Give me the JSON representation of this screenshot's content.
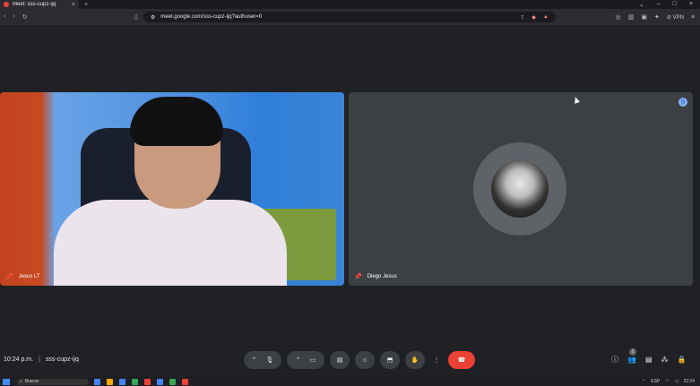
{
  "browser": {
    "tab_title": "Meet: sss-cupz-ijq",
    "url": "meet.google.com/sss-cupz-ijq?authuser=0",
    "vpn_label": "VPN"
  },
  "tiles": [
    {
      "name": "Jesus LT"
    },
    {
      "name": "Diego Jesus"
    }
  ],
  "meeting": {
    "time": "10:24 p.m.",
    "separator": "|",
    "code": "sss-cupz-ijq",
    "participants_count": "2"
  },
  "taskbar": {
    "search_placeholder": "Buscar",
    "lang": "ESP",
    "clock_time": "22:24",
    "clock_date": ""
  }
}
